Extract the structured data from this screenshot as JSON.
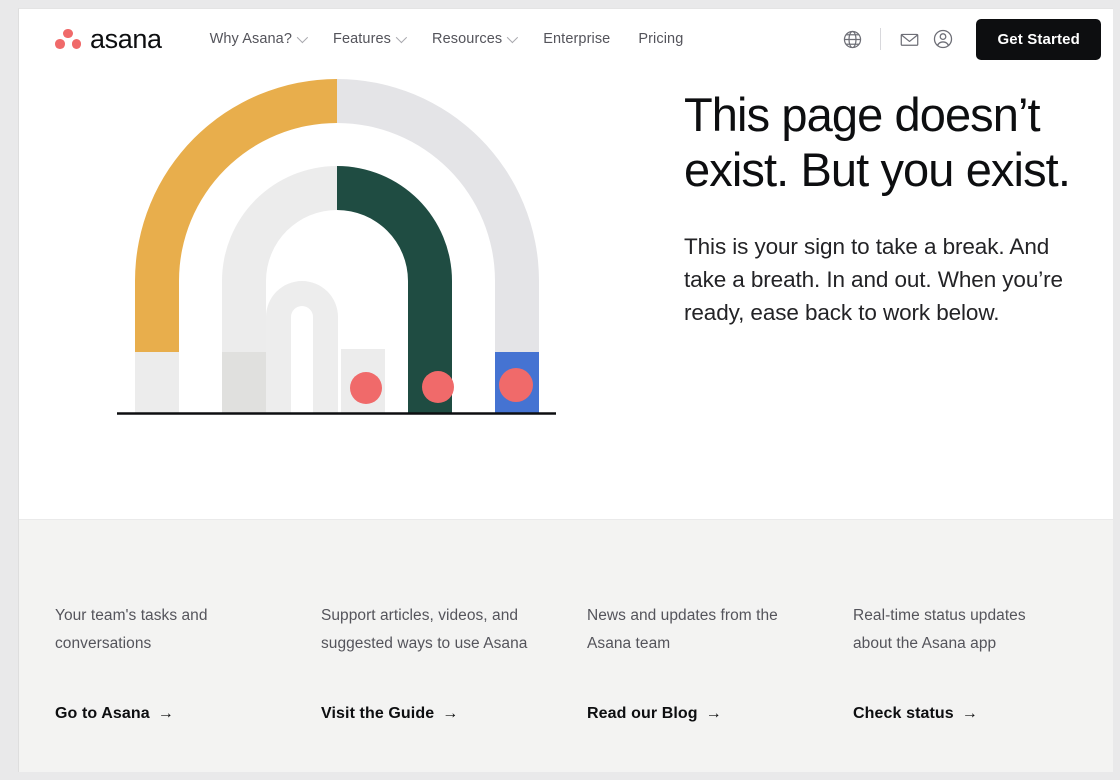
{
  "brand": {
    "name": "asana",
    "logo_icon": "asana-three-dots-logo",
    "dot_color": "#f06a6a",
    "wordmark_color": "#0d0e10"
  },
  "header": {
    "nav": [
      {
        "label": "Why Asana?",
        "has_dropdown": true,
        "icon": "chevron-down-icon"
      },
      {
        "label": "Features",
        "has_dropdown": true,
        "icon": "chevron-down-icon"
      },
      {
        "label": "Resources",
        "has_dropdown": true,
        "icon": "chevron-down-icon"
      },
      {
        "label": "Enterprise",
        "has_dropdown": false
      },
      {
        "label": "Pricing",
        "has_dropdown": false
      }
    ],
    "icons": [
      {
        "name": "globe-icon",
        "title": "Language"
      },
      {
        "name": "envelope-icon",
        "title": "Contact sales"
      },
      {
        "name": "user-account-icon",
        "title": "Log in"
      }
    ],
    "cta": {
      "label": "Get Started",
      "bg": "#0d0e10",
      "fg": "#ffffff"
    }
  },
  "hero": {
    "title": "This page doesn’t exist. But you exist.",
    "subtitle": "This is your sign to take a break. And take a breath. In and out. When you’re ready, ease back to work below.",
    "illustration": {
      "name": "concentric-arches-illustration",
      "colors": {
        "yellow": "#e8ae4c",
        "light_gray": "#e8e8e9",
        "pale_gray": "#e3e3e6",
        "mid_gray": "#dededd",
        "green": "#1f4c42",
        "blue": "#4573d2",
        "coral": "#f06a6a",
        "ground_line": "#0d0e10"
      },
      "dots": 3
    }
  },
  "lower": {
    "background": "#f3f3f2",
    "columns": [
      {
        "description": "Your team's tasks and conversations",
        "link": "Go to Asana",
        "arrow": "→"
      },
      {
        "description": "Support articles, videos, and suggested ways to use Asana",
        "link": "Visit the Guide",
        "arrow": "→"
      },
      {
        "description": "News and updates from the Asana team",
        "link": "Read our Blog",
        "arrow": "→"
      },
      {
        "description": "Real-time status updates about the Asana app",
        "link": "Check status",
        "arrow": "→"
      }
    ]
  }
}
